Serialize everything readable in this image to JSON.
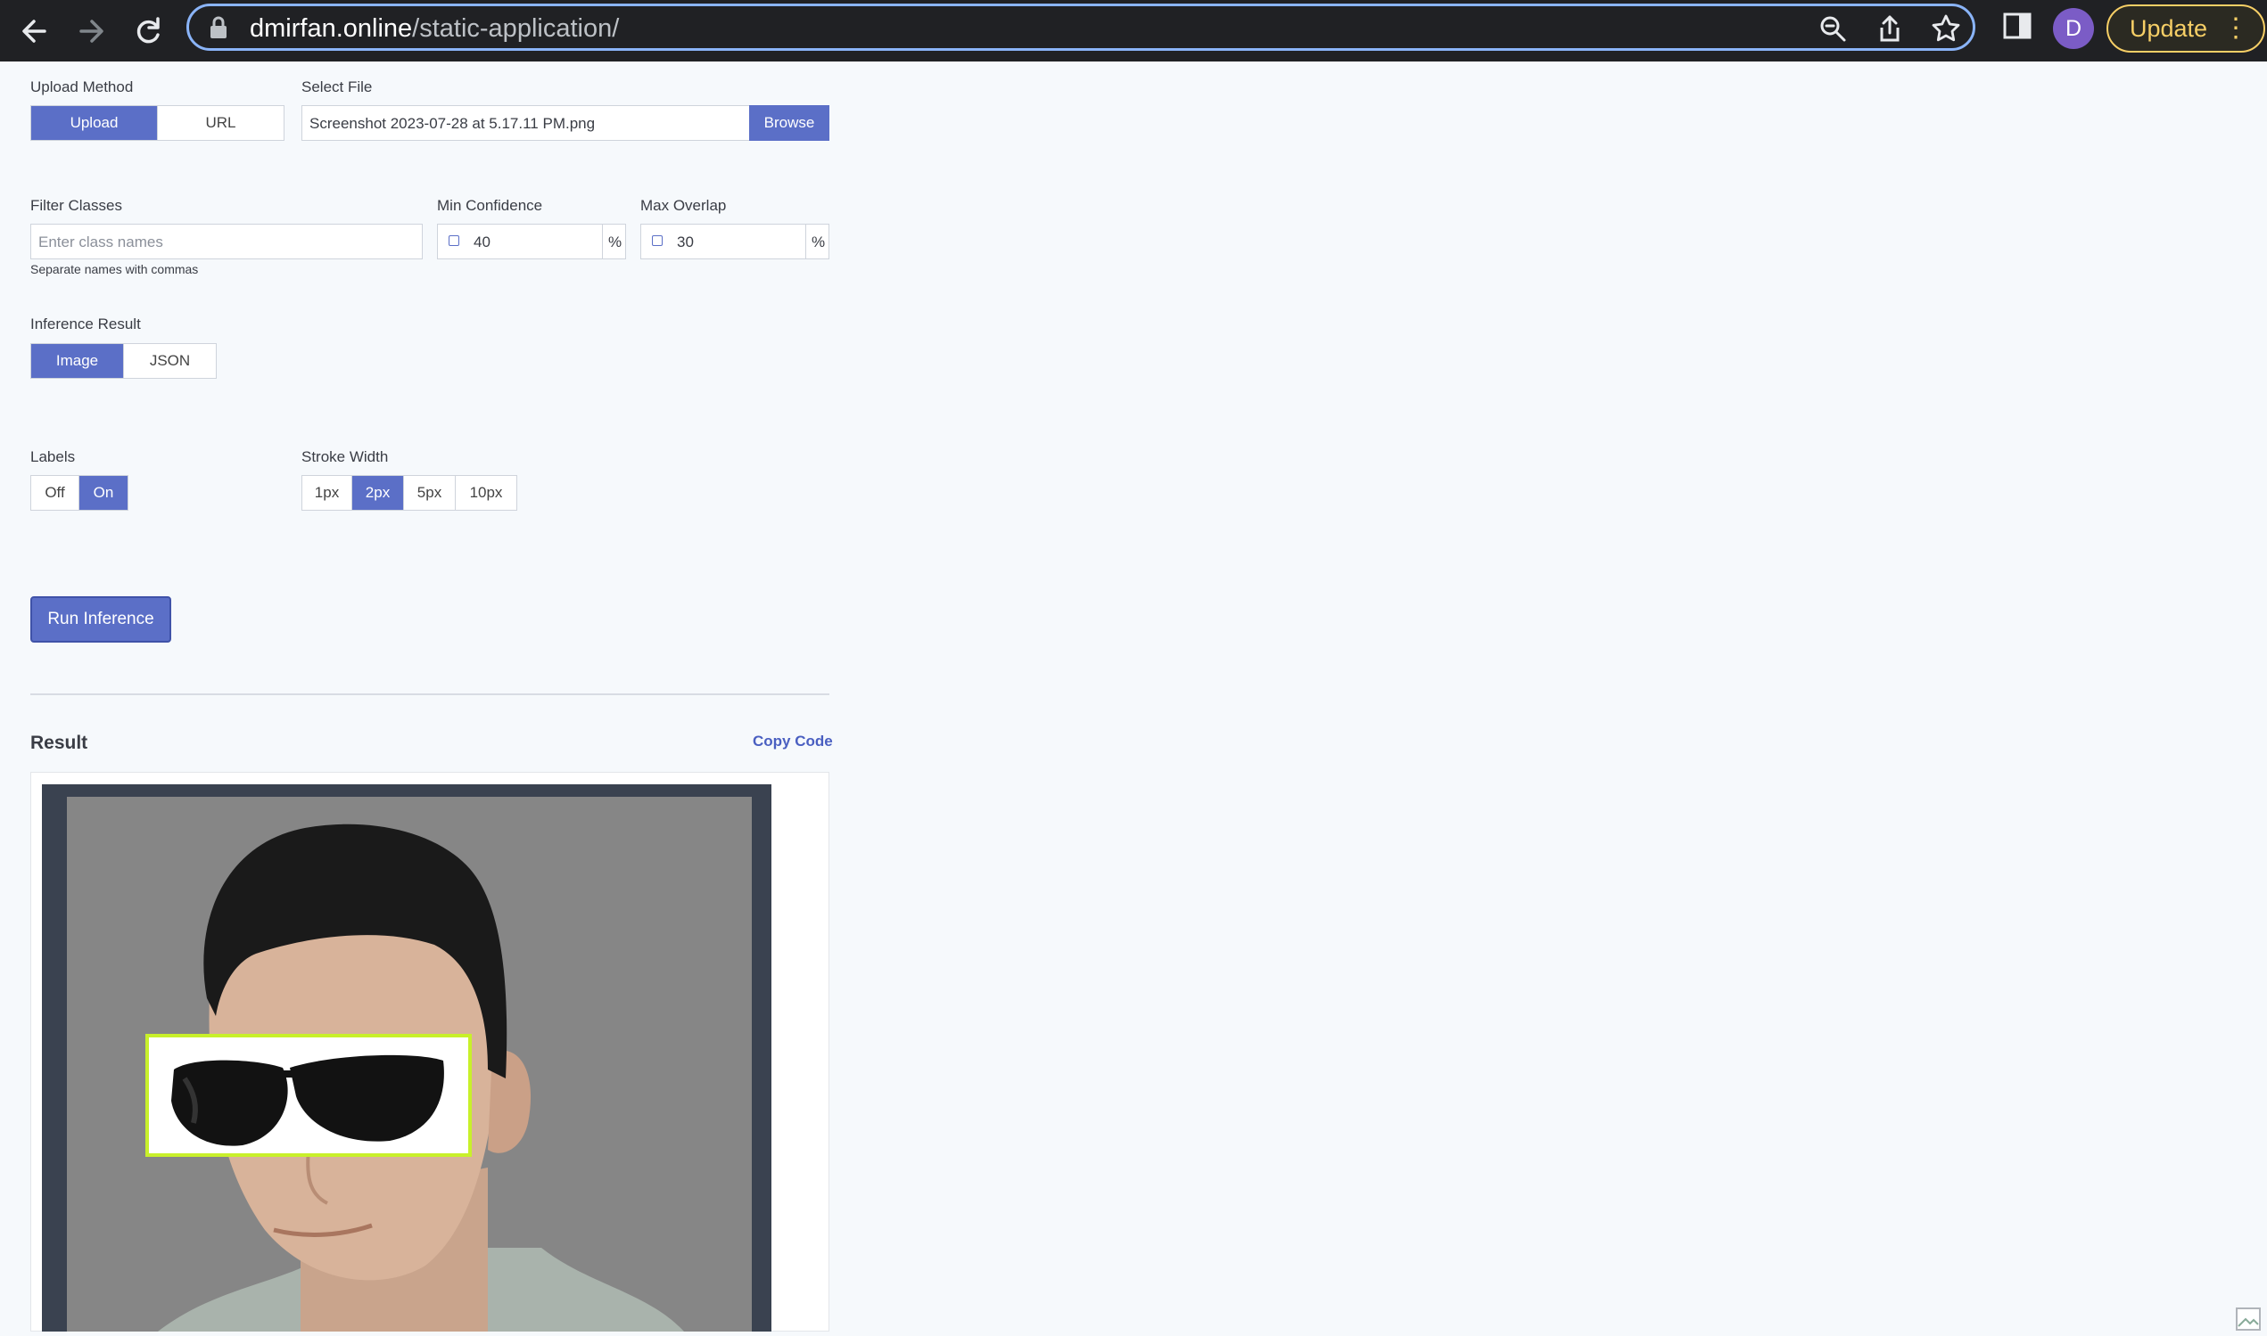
{
  "browser": {
    "url_host": "dmirfan.online",
    "url_path": "/static-application/",
    "profile_initial": "D",
    "update_label": "Update",
    "menu_glyph": "⋮"
  },
  "form": {
    "upload_method": {
      "label": "Upload Method",
      "options": [
        "Upload",
        "URL"
      ],
      "selected": "Upload"
    },
    "select_file": {
      "label": "Select File",
      "value": "Screenshot 2023-07-28 at 5.17.11 PM.png",
      "browse_label": "Browse"
    },
    "filter_classes": {
      "label": "Filter Classes",
      "placeholder": "Enter class names",
      "hint": "Separate names with commas"
    },
    "min_confidence": {
      "label": "Min Confidence",
      "value": "40",
      "unit": "%"
    },
    "max_overlap": {
      "label": "Max Overlap",
      "value": "30",
      "unit": "%"
    },
    "inference_result": {
      "label": "Inference Result",
      "options": [
        "Image",
        "JSON"
      ],
      "selected": "Image"
    },
    "labels": {
      "label": "Labels",
      "options": [
        "Off",
        "On"
      ],
      "selected": "On"
    },
    "stroke_width": {
      "label": "Stroke Width",
      "options": [
        "1px",
        "2px",
        "5px",
        "10px"
      ],
      "selected": "2px"
    },
    "run_label": "Run Inference"
  },
  "result": {
    "title": "Result",
    "copy_label": "Copy Code",
    "image_alt": "Inference result: portrait with sunglasses detected",
    "detection_box_color": "#c8f02a"
  }
}
